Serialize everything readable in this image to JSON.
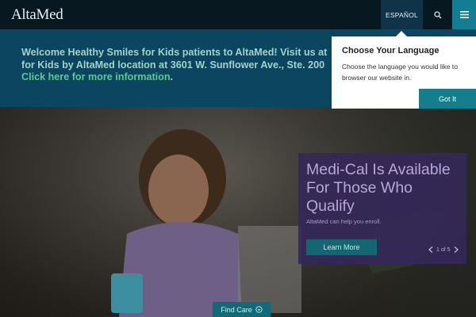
{
  "header": {
    "logo": "AltaMed",
    "language_button": "ESPAÑOL",
    "search_icon": "search-icon",
    "menu_icon": "hamburger-menu-icon"
  },
  "banner": {
    "line1": "Welcome Healthy Smiles for Kids patients to AltaMed! Visit us at",
    "line2": "for Kids by AltaMed location at 3601 W. Sunflower Ave., Ste. 200",
    "link": "Click here for more information",
    "link_suffix": "."
  },
  "popover": {
    "title": "Choose Your Language",
    "body": "Choose the language you would like to browser our website in.",
    "button": "Got It"
  },
  "promo": {
    "title": "Medi-Cal Is Available For Those Who Qualify",
    "subtitle": "AltaMed can help you enroll.",
    "button": "Learn More",
    "pager": "1 of 5"
  },
  "hero": {
    "find_care": "Find Care"
  },
  "colors": {
    "header_bg": "#071820",
    "banner_bg": "#0b4560",
    "banner_text": "#a4d2c7",
    "banner_link": "#5cc996",
    "accent_teal": "#117f91",
    "promo_bg": "#34285a"
  }
}
